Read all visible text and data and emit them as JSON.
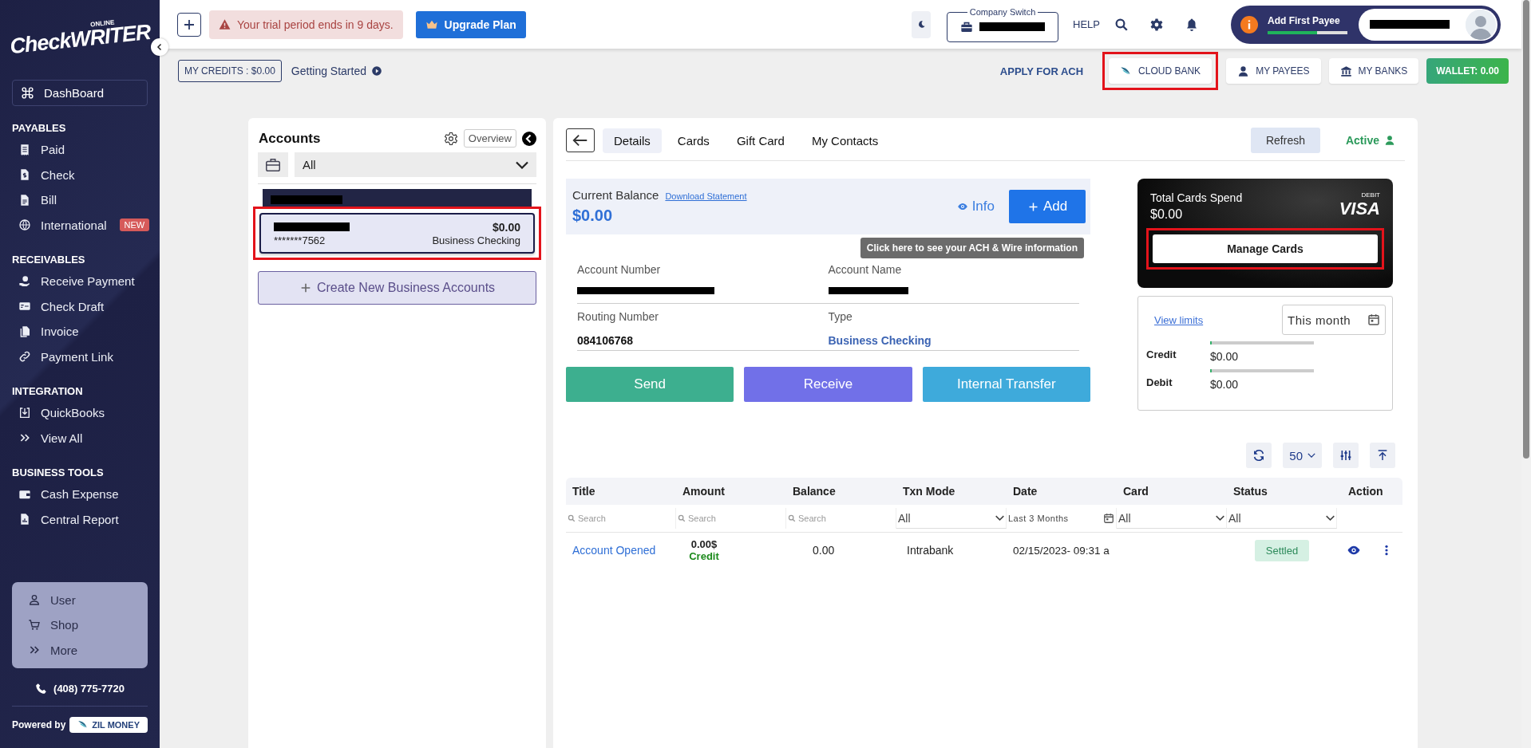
{
  "sidebar": {
    "logo_tagline": "ONLINE",
    "logo_wordmark": "CheckWRITER",
    "dashboard": "DashBoard",
    "sections": [
      {
        "title": "PAYABLES",
        "items": [
          {
            "label": "Paid"
          },
          {
            "label": "Check"
          },
          {
            "label": "Bill"
          },
          {
            "label": "International",
            "badge": "NEW"
          }
        ]
      },
      {
        "title": "RECEIVABLES",
        "items": [
          {
            "label": "Receive Payment"
          },
          {
            "label": "Check Draft"
          },
          {
            "label": "Invoice"
          },
          {
            "label": "Payment Link"
          }
        ]
      },
      {
        "title": "INTEGRATION",
        "items": [
          {
            "label": "QuickBooks"
          },
          {
            "label": "View All"
          }
        ]
      },
      {
        "title": "BUSINESS TOOLS",
        "items": [
          {
            "label": "Cash Expense"
          },
          {
            "label": "Central Report"
          }
        ]
      }
    ],
    "bottom_menu": [
      {
        "label": "User"
      },
      {
        "label": "Shop"
      },
      {
        "label": "More"
      }
    ],
    "phone": "(408) 775-7720",
    "powered_by": "Powered by",
    "partner": "ZIL MONEY"
  },
  "top_bar": {
    "trial_notice": "Your trial period ends in 9 days.",
    "upgrade_button": "Upgrade Plan",
    "company_switch": "Company Switch",
    "help": "HELP",
    "payee_prompt": {
      "label": "Add First Payee",
      "level": 0.62
    }
  },
  "action_bar": {
    "credits": "MY CREDITS : $0.00",
    "getting_started": "Getting Started",
    "links": [
      {
        "label": "APPLY FOR ACH",
        "kind": "text",
        "highlighted": false
      },
      {
        "label": "CLOUD BANK",
        "kind": "cloud",
        "highlighted": true
      },
      {
        "label": "MY PAYEES",
        "kind": "person",
        "highlighted": false
      },
      {
        "label": "MY BANKS",
        "kind": "bank",
        "highlighted": false
      },
      {
        "label": "WALLET: 0.00",
        "kind": "wallet",
        "highlighted": false
      }
    ]
  },
  "accounts": {
    "title": "Accounts",
    "overview": "Overview",
    "filter": "All",
    "list": [
      {
        "balance": "$0.00",
        "number": "*******7562",
        "type": "Business Checking",
        "selected": true,
        "highlighted": true
      }
    ],
    "create_button": "Create New Business Accounts"
  },
  "details": {
    "tabs": [
      {
        "label": "Details",
        "selected": true
      },
      {
        "label": "Cards",
        "selected": false
      },
      {
        "label": "Gift Card",
        "selected": false
      },
      {
        "label": "My Contacts",
        "selected": false
      }
    ],
    "refresh": "Refresh",
    "status": "Active",
    "balance": {
      "label": "Current Balance",
      "statement_link": "Download Statement",
      "amount": "$0.00",
      "info": "Info",
      "add": "Add",
      "tooltip": "Click here to see your ACH & Wire information"
    },
    "fields": [
      {
        "label": "Account Number",
        "kind": "redacted"
      },
      {
        "label": "Account Name",
        "kind": "redacted"
      },
      {
        "label": "Routing Number",
        "kind": "text",
        "value": "084106768"
      },
      {
        "label": "Type",
        "kind": "link",
        "value": "Business Checking"
      }
    ],
    "buttons": [
      {
        "label": "Send",
        "color": "#3daf8f"
      },
      {
        "label": "Receive",
        "color": "#7170e8"
      },
      {
        "label": "Internal Transfer",
        "color": "#3eaadb"
      }
    ],
    "card": {
      "title": "Total Cards Spend",
      "amount": "$0.00",
      "network_type": "DEBIT",
      "network": "VISA",
      "manage_button": "Manage Cards",
      "highlighted": true
    },
    "limits": {
      "link": "View limits",
      "period": "This month",
      "rows": [
        {
          "label": "Credit",
          "level": 0.01,
          "amount": "$0.00"
        },
        {
          "label": "Debit",
          "level": 0.01,
          "amount": "$0.00"
        }
      ]
    }
  },
  "table": {
    "page_size": "50",
    "columns": [
      "Title",
      "Amount",
      "Balance",
      "Txn Mode",
      "Date",
      "Card",
      "Status",
      "Action"
    ],
    "filters": [
      {
        "kind": "search",
        "placeholder": "Search"
      },
      {
        "kind": "search",
        "placeholder": "Search"
      },
      {
        "kind": "search",
        "placeholder": "Search"
      },
      {
        "kind": "select",
        "value": "All"
      },
      {
        "kind": "date",
        "value": "Last 3 Months"
      },
      {
        "kind": "select",
        "value": "All"
      },
      {
        "kind": "select",
        "value": "All"
      },
      {
        "kind": "none"
      }
    ],
    "rows": [
      {
        "title": "Account Opened",
        "amount": "0.00$",
        "amount_type": "Credit",
        "balance": "0.00",
        "mode": "Intrabank",
        "date": "02/15/2023- 09:31 a",
        "status": "Settled"
      }
    ]
  }
}
